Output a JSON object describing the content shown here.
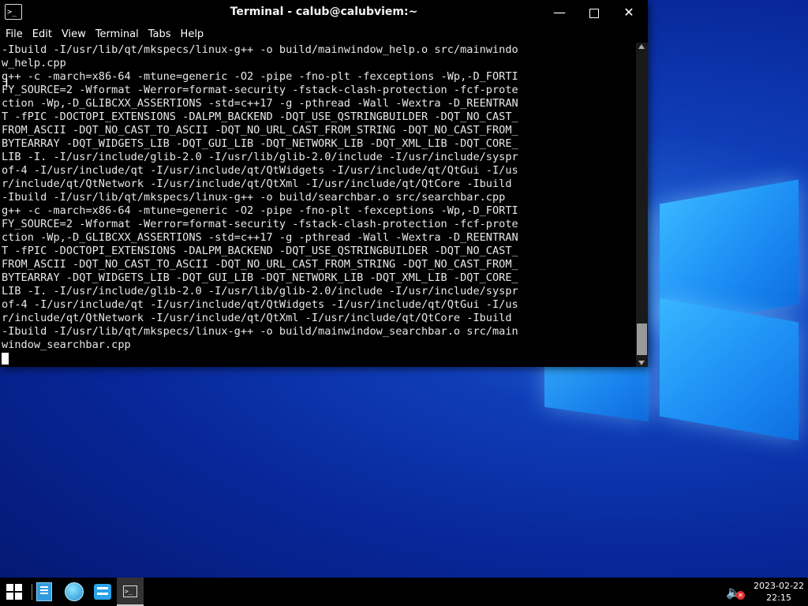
{
  "window": {
    "title": "Terminal - calub@calubviem:~",
    "app_icon_glyph": ">_",
    "controls": {
      "minimize": "—",
      "close": "✕"
    }
  },
  "menu": [
    "File",
    "Edit",
    "View",
    "Terminal",
    "Tabs",
    "Help"
  ],
  "terminal_lines": [
    "-Ibuild -I/usr/lib/qt/mkspecs/linux-g++ -o build/mainwindow_help.o src/mainwindo",
    "w_help.cpp",
    "g++ -c -march=x86-64 -mtune=generic -O2 -pipe -fno-plt -fexceptions -Wp,-D_FORTI",
    "FY_SOURCE=2 -Wformat -Werror=format-security -fstack-clash-protection -fcf-prote",
    "ction -Wp,-D_GLIBCXX_ASSERTIONS -std=c++17 -g -pthread -Wall -Wextra -D_REENTRAN",
    "T -fPIC -DOCTOPI_EXTENSIONS -DALPM_BACKEND -DQT_USE_QSTRINGBUILDER -DQT_NO_CAST_",
    "FROM_ASCII -DQT_NO_CAST_TO_ASCII -DQT_NO_URL_CAST_FROM_STRING -DQT_NO_CAST_FROM_",
    "BYTEARRAY -DQT_WIDGETS_LIB -DQT_GUI_LIB -DQT_NETWORK_LIB -DQT_XML_LIB -DQT_CORE_",
    "LIB -I. -I/usr/include/glib-2.0 -I/usr/lib/glib-2.0/include -I/usr/include/syspr",
    "of-4 -I/usr/include/qt -I/usr/include/qt/QtWidgets -I/usr/include/qt/QtGui -I/us",
    "r/include/qt/QtNetwork -I/usr/include/qt/QtXml -I/usr/include/qt/QtCore -Ibuild",
    "-Ibuild -I/usr/lib/qt/mkspecs/linux-g++ -o build/searchbar.o src/searchbar.cpp",
    "g++ -c -march=x86-64 -mtune=generic -O2 -pipe -fno-plt -fexceptions -Wp,-D_FORTI",
    "FY_SOURCE=2 -Wformat -Werror=format-security -fstack-clash-protection -fcf-prote",
    "ction -Wp,-D_GLIBCXX_ASSERTIONS -std=c++17 -g -pthread -Wall -Wextra -D_REENTRAN",
    "T -fPIC -DOCTOPI_EXTENSIONS -DALPM_BACKEND -DQT_USE_QSTRINGBUILDER -DQT_NO_CAST_",
    "FROM_ASCII -DQT_NO_CAST_TO_ASCII -DQT_NO_URL_CAST_FROM_STRING -DQT_NO_CAST_FROM_",
    "BYTEARRAY -DQT_WIDGETS_LIB -DQT_GUI_LIB -DQT_NETWORK_LIB -DQT_XML_LIB -DQT_CORE_",
    "LIB -I. -I/usr/include/glib-2.0 -I/usr/lib/glib-2.0/include -I/usr/include/syspr",
    "of-4 -I/usr/include/qt -I/usr/include/qt/QtWidgets -I/usr/include/qt/QtGui -I/us",
    "r/include/qt/QtNetwork -I/usr/include/qt/QtXml -I/usr/include/qt/QtCore -Ibuild",
    "-Ibuild -I/usr/lib/qt/mkspecs/linux-g++ -o build/mainwindow_searchbar.o src/main",
    "window_searchbar.cpp"
  ],
  "taskbar": {
    "apps": [
      "start-icon",
      "file-manager-icon",
      "browser-icon",
      "settings-icon",
      "terminal-icon"
    ],
    "terminal_glyph": ">_",
    "volume_muted": true,
    "date": "2023-02-22",
    "time": "22:15"
  },
  "colors": {
    "desktop": "#0a2fa8",
    "terminal_bg": "#000000",
    "terminal_fg": "#e8e8e8",
    "accent": "#1d8ff5"
  }
}
